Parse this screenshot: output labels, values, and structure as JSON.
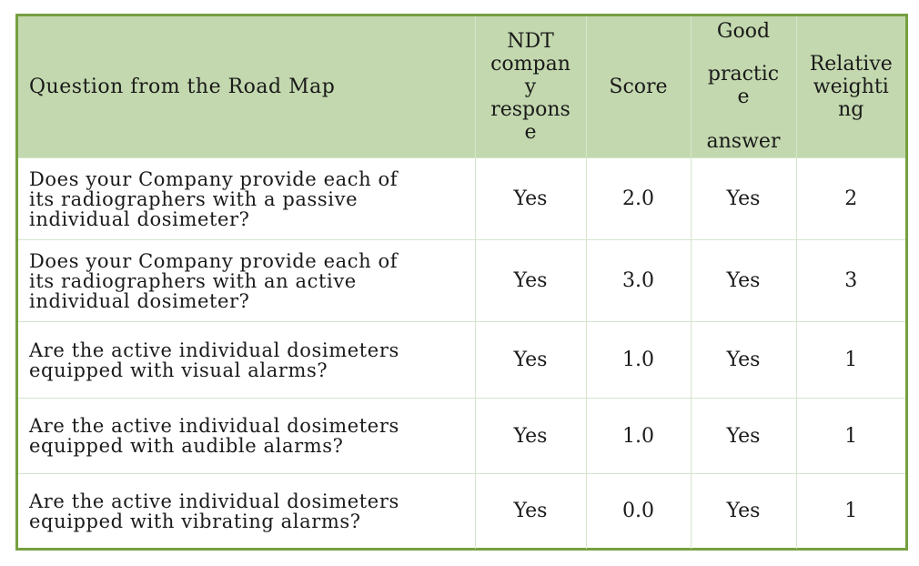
{
  "table": {
    "columns": [
      {
        "label": "Question from the Road Map"
      },
      {
        "label": "NDT company response"
      },
      {
        "label": "Score"
      },
      {
        "label": "Good practice answer"
      },
      {
        "label": "Relative weighting"
      }
    ],
    "header_display": {
      "ndt": [
        "NDT",
        "compan",
        "y",
        "respons",
        "e"
      ],
      "good": [
        "Good",
        "",
        "practic",
        "e",
        "",
        "answer"
      ],
      "weight": [
        "Relative",
        "weighti",
        "ng"
      ]
    },
    "rows": [
      {
        "question": "Does your Company provide each of its radiographers with a passive individual dosimeter?",
        "question_lines": [
          "Does your Company provide each of",
          "its radiographers with a passive",
          "individual dosimeter?"
        ],
        "response": "Yes",
        "score": "2.0",
        "good_practice": "Yes",
        "weighting": "2"
      },
      {
        "question": "Does your Company provide each of its radiographers with an active individual dosimeter?",
        "question_lines": [
          "Does your Company provide each of",
          "its radiographers with an active",
          "individual dosimeter?"
        ],
        "response": "Yes",
        "score": "3.0",
        "good_practice": "Yes",
        "weighting": "3"
      },
      {
        "question": "Are the active individual dosimeters equipped with visual alarms?",
        "question_lines": [
          "Are the active individual dosimeters",
          "equipped with visual alarms?"
        ],
        "response": "Yes",
        "score": "1.0",
        "good_practice": "Yes",
        "weighting": "1"
      },
      {
        "question": "Are the active individual dosimeters equipped with audible alarms?",
        "question_lines": [
          "Are the active individual dosimeters",
          "equipped with audible alarms?"
        ],
        "response": "Yes",
        "score": "1.0",
        "good_practice": "Yes",
        "weighting": "1"
      },
      {
        "question": "Are the active individual dosimeters equipped with vibrating alarms?",
        "question_lines": [
          "Are the active individual dosimeters",
          "equipped with vibrating alarms?"
        ],
        "response": "Yes",
        "score": "0.0",
        "good_practice": "Yes",
        "weighting": "1"
      }
    ]
  },
  "colors": {
    "border": "#76a040",
    "header_bg": "#c3d8ae",
    "grid": "#d5e6cc"
  }
}
